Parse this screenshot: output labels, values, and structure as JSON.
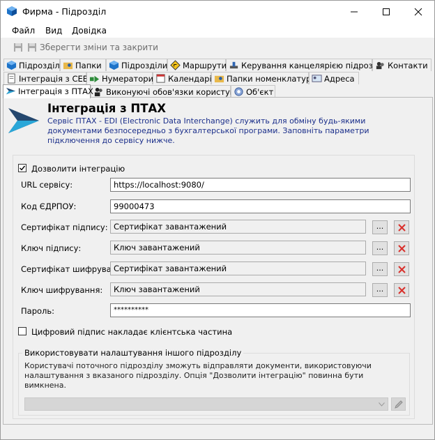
{
  "window": {
    "title": "Фирма - Підрозділ"
  },
  "menu": {
    "items": [
      "Файл",
      "Вид",
      "Довідка"
    ]
  },
  "toolbar": {
    "save_close_label": "Зберегти зміни та закрити"
  },
  "tabs": {
    "row1": [
      "Підрозділ",
      "Папки",
      "Підрозділи",
      "Маршрути",
      "Керування канцелярією підрозділу",
      "Контакти"
    ],
    "row2": [
      "Інтеграція з СЕВ",
      "Нумератори",
      "Календарі",
      "Папки номенклатури",
      "Адреса"
    ],
    "row3": [
      "Інтеграція з ПТАХ",
      "Виконуючі обов'язки користувачі",
      "Об'єкт"
    ]
  },
  "section": {
    "title": "Інтеграція з ПТАХ",
    "description": "Сервіс ПТАХ - EDI (Electronic Data Interchange) служить для обміну будь-якими документами безпосередньо з бухгалтерської програми. Заповніть параметри підключення до сервісу нижче."
  },
  "form": {
    "allow_integration_label": "Дозволити інтеграцію",
    "allow_integration_checked": true,
    "url_label": "URL сервісу:",
    "url_value": "https://localhost:9080/",
    "edrpou_label": "Код ЄДРПОУ:",
    "edrpou_value": "99000473",
    "sign_cert_label": "Сертифікат підпису:",
    "sign_cert_value": "Сертифікат завантажений",
    "sign_key_label": "Ключ підпису:",
    "sign_key_value": "Ключ завантажений",
    "enc_cert_label": "Сертифікат шифрування:",
    "enc_cert_value": "Сертифікат завантажений",
    "enc_key_label": "Ключ шифрування:",
    "enc_key_value": "Ключ завантажений",
    "password_label": "Пароль:",
    "password_value": "**********",
    "browse_label": "...",
    "client_sign_label": "Цифровий підпис накладає клієнтська частина",
    "client_sign_checked": false
  },
  "other_unit": {
    "legend": "Використовувати налаштування іншого підрозділу",
    "description": "Користувачі поточного підрозділу зможуть відправляти документи, використовуючи налаштування з вказаного підрозділу. Опція \"Дозволити інтеграцію\" повинна бути вимкнена.",
    "selected": ""
  },
  "colors": {
    "description_text": "#1a2e8a",
    "delete_icon": "#d9302c",
    "app_icon": "#1e73c8"
  },
  "icons": {
    "app": "cube-icon",
    "logo": "ptah-arrow-logo-icon",
    "delete": "red-x-icon",
    "edit": "pencil-icon"
  }
}
